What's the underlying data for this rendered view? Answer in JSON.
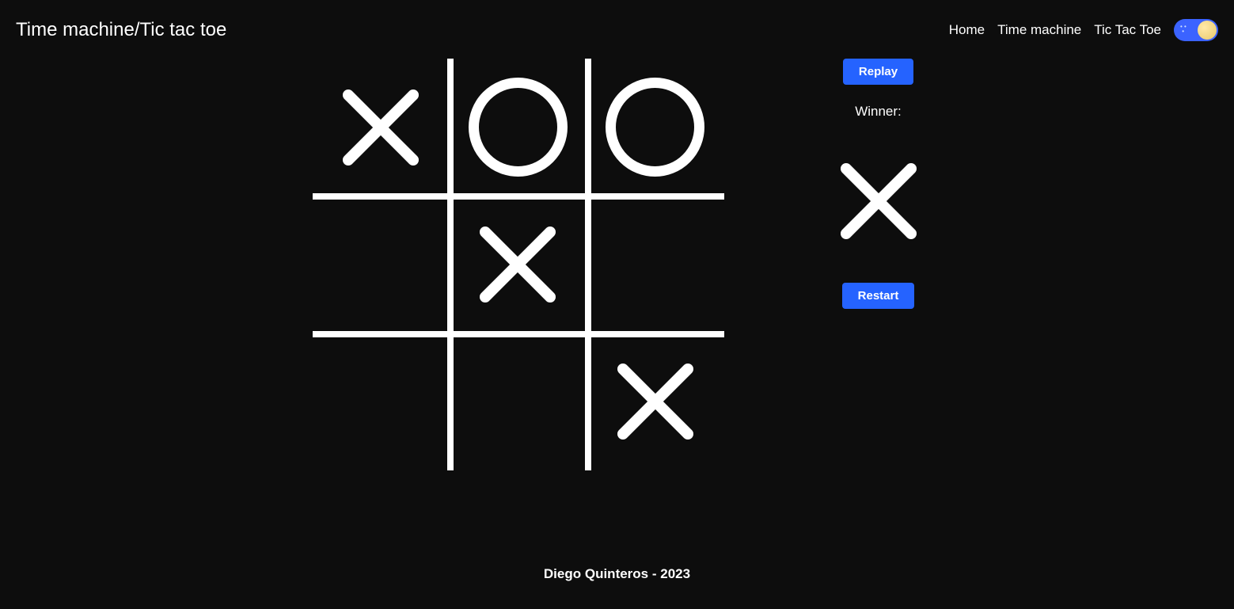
{
  "header": {
    "title": "Time machine/Tic tac toe",
    "nav": {
      "home": "Home",
      "time_machine": "Time machine",
      "tic_tac_toe": "Tic Tac Toe"
    }
  },
  "game": {
    "board": [
      "X",
      "O",
      "O",
      "",
      "X",
      "",
      "",
      "",
      "X"
    ],
    "replay_label": "Replay",
    "winner_label": "Winner:",
    "winner_mark": "X",
    "restart_label": "Restart"
  },
  "footer": {
    "text": "Diego Quinteros - 2023"
  }
}
